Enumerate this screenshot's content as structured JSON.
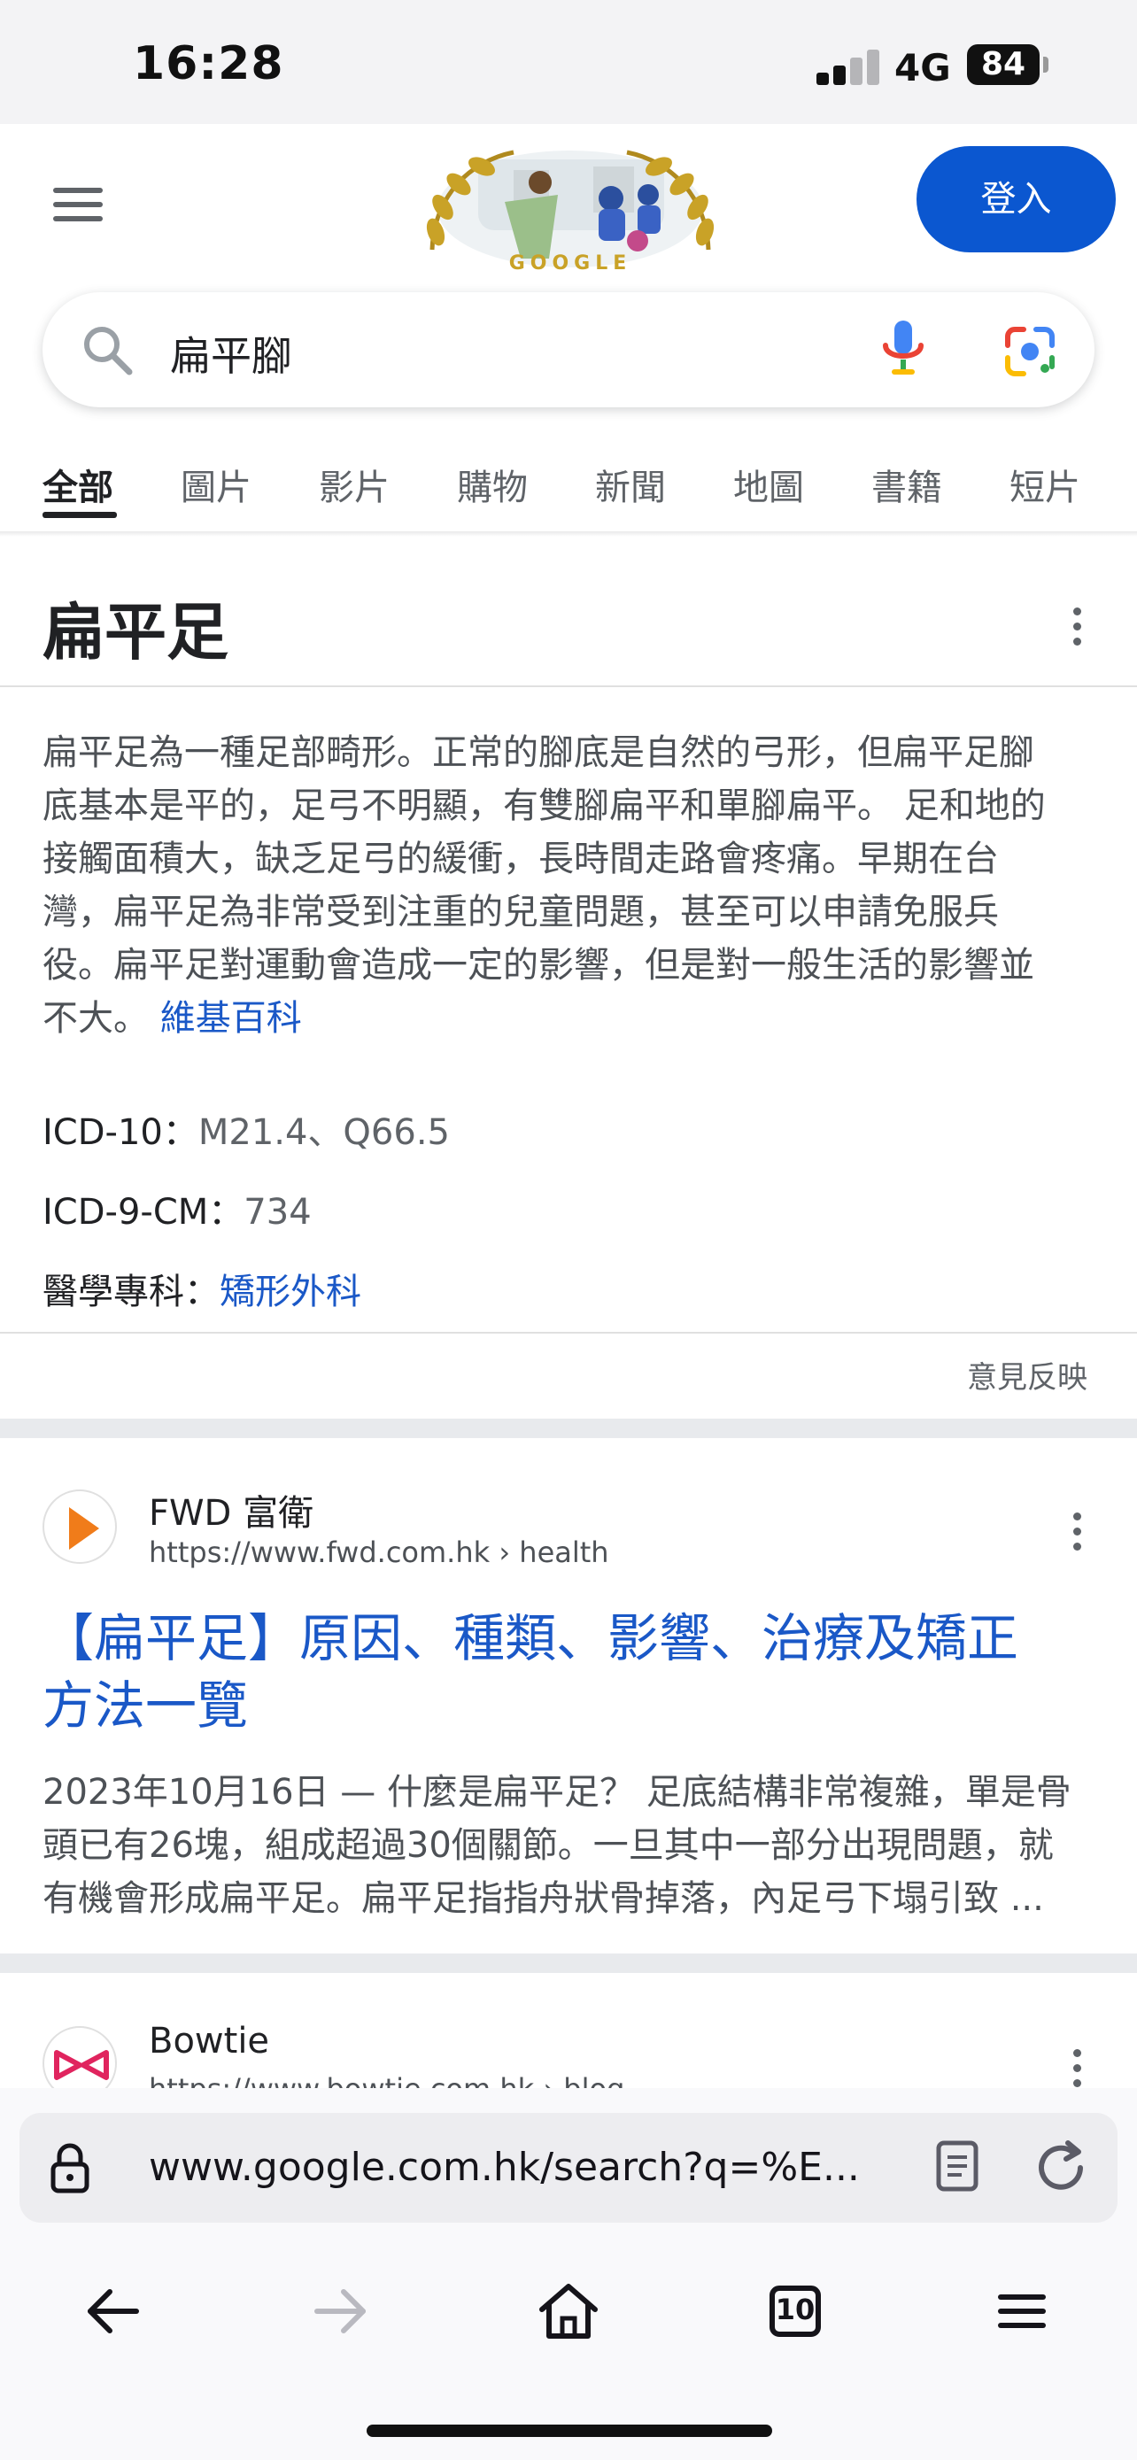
{
  "status_bar": {
    "time": "16:28",
    "network": "4G",
    "battery": "84"
  },
  "header": {
    "login_label": "登入",
    "doodle_text": "GOOGLE"
  },
  "search": {
    "query": "扁平腳"
  },
  "tabs": [
    {
      "label": "全部"
    },
    {
      "label": "圖片"
    },
    {
      "label": "影片"
    },
    {
      "label": "購物"
    },
    {
      "label": "新聞"
    },
    {
      "label": "地圖"
    },
    {
      "label": "書籍"
    },
    {
      "label": "短片"
    }
  ],
  "knowledge_panel": {
    "title": "扁平足",
    "description_lines": [
      "扁平足為一種足部畸形。正常的腳底是自然的弓形，但扁平足腳",
      "底基本是平的，足弓不明顯，有雙腳扁平和單腳扁平。 足和地的",
      "接觸面積大，缺乏足弓的緩衝，長時間走路會疼痛。早期在台",
      "灣，扁平足為非常受到注重的兒童問題，甚至可以申請免服兵",
      "役。扁平足對運動會造成一定的影響，但是對一般生活的影響並",
      "不大。"
    ],
    "source_link": "維基百科",
    "facts": [
      {
        "label": "ICD-10：",
        "value": "M21.4、Q66.5"
      },
      {
        "label": "ICD-9-CM：",
        "value": "734"
      },
      {
        "label": "醫學專科：",
        "value": "矯形外科"
      }
    ],
    "feedback": "意見反映"
  },
  "results": [
    {
      "site_name": "FWD 富衛",
      "url": "https://www.fwd.com.hk › health",
      "title_lines": [
        "【扁平足】原因、種類、影響、治療及矯正",
        "方法一覽"
      ],
      "snippet_lines": [
        "2023年10月16日 — 什麼是扁平足？ 足底結構非常複雜，單是骨",
        "頭已有26塊，組成超過30個關節。一旦其中一部分出現問題，就",
        "有機會形成扁平足。扁平足指指舟狀骨掉落，內足弓下塌引致 ..."
      ]
    },
    {
      "site_name": "Bowtie",
      "url": "https://www.bowtie.com.hk › blog"
    }
  ],
  "browser": {
    "url": "www.google.com.hk/search?q=%E...",
    "tab_count": "10"
  },
  "colors": {
    "accent": "#0b57d0",
    "link": "#1a58c7",
    "text": "#202124",
    "muted": "#4d5156"
  }
}
